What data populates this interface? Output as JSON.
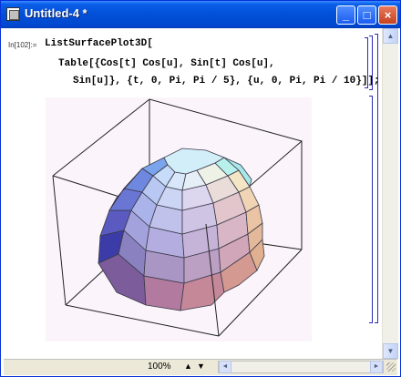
{
  "window": {
    "title": "Untitled-4 *",
    "buttons": {
      "minimize": "_",
      "maximize": "□",
      "close": "×"
    }
  },
  "notebook": {
    "input_label": "In[102]:=",
    "code_lines": [
      "ListSurfacePlot3D[",
      "Table[{Cos[t] Cos[u], Sin[t] Cos[u],",
      "Sin[u]}, {t, 0, Pi, Pi / 5}, {u, 0, Pi, Pi / 10}]];"
    ]
  },
  "plot": {
    "kind": "3D surface: hemisphere of polygon faces inside bounding box",
    "colors": {
      "deep_blue": "#2a2a9a",
      "lavender": "#b9b6e6",
      "pink": "#d7a0b8",
      "orange": "#f0c090",
      "cyan": "#b8f0ec"
    }
  },
  "statusbar": {
    "zoom": "100%",
    "scroll_left": "◄",
    "scroll_right": "►"
  }
}
